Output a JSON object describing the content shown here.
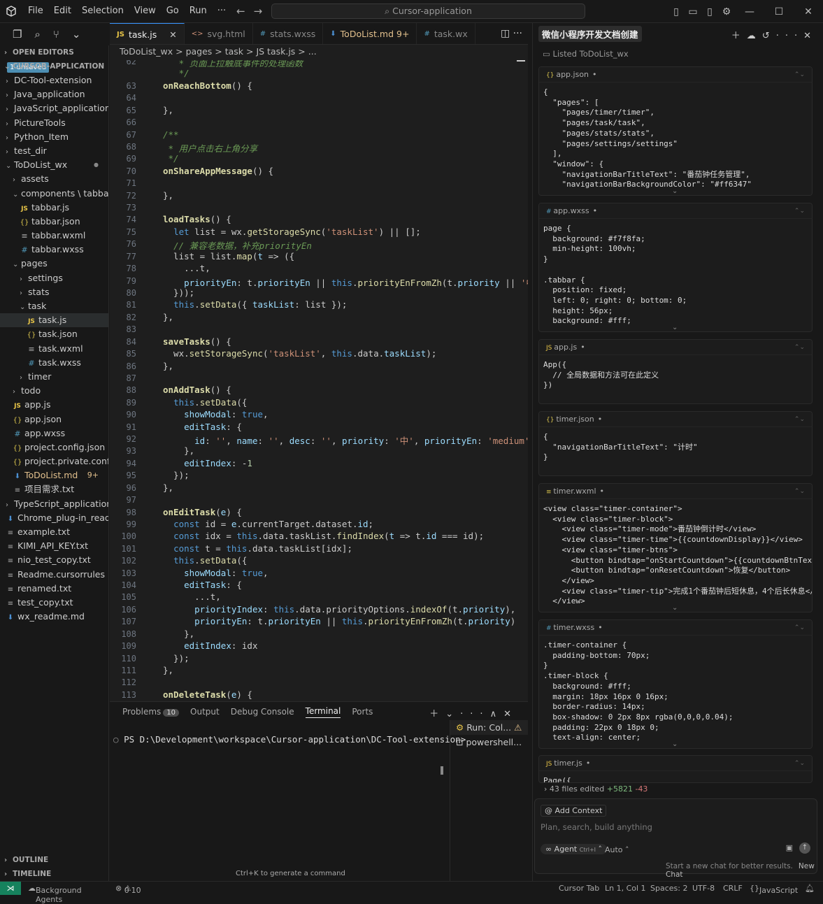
{
  "menu": [
    "File",
    "Edit",
    "Selection",
    "View",
    "Go",
    "Run",
    "···"
  ],
  "command_center": "Cursor-application",
  "sidebar": {
    "open_editors": "OPEN EDITORS",
    "unsaved": "1 unsaved",
    "root": "CURSOR-APPLICATION",
    "outline": "OUTLINE",
    "timeline": "TIMELINE",
    "items": [
      {
        "label": "DC-Tool-extension",
        "indent": 0,
        "type": "folder",
        "open": false
      },
      {
        "label": "Java_application",
        "indent": 0,
        "type": "folder",
        "open": false
      },
      {
        "label": "JavaScript_application",
        "indent": 0,
        "type": "folder",
        "open": false
      },
      {
        "label": "PictureTools",
        "indent": 0,
        "type": "folder",
        "open": false
      },
      {
        "label": "Python_Item",
        "indent": 0,
        "type": "folder",
        "open": false
      },
      {
        "label": "test_dir",
        "indent": 0,
        "type": "folder",
        "open": false
      },
      {
        "label": "ToDoList_wx",
        "indent": 0,
        "type": "folder",
        "open": true,
        "dot": true
      },
      {
        "label": "assets",
        "indent": 1,
        "type": "folder",
        "open": false
      },
      {
        "label": "components \\ tabbar",
        "indent": 1,
        "type": "folder",
        "open": true
      },
      {
        "label": "tabbar.js",
        "indent": 2,
        "type": "js"
      },
      {
        "label": "tabbar.json",
        "indent": 2,
        "type": "json"
      },
      {
        "label": "tabbar.wxml",
        "indent": 2,
        "type": "wxml"
      },
      {
        "label": "tabbar.wxss",
        "indent": 2,
        "type": "css"
      },
      {
        "label": "pages",
        "indent": 1,
        "type": "folder",
        "open": true
      },
      {
        "label": "settings",
        "indent": 2,
        "type": "folder",
        "open": false
      },
      {
        "label": "stats",
        "indent": 2,
        "type": "folder",
        "open": false
      },
      {
        "label": "task",
        "indent": 2,
        "type": "folder",
        "open": true
      },
      {
        "label": "task.js",
        "indent": 3,
        "type": "js",
        "selected": true
      },
      {
        "label": "task.json",
        "indent": 3,
        "type": "json"
      },
      {
        "label": "task.wxml",
        "indent": 3,
        "type": "wxml"
      },
      {
        "label": "task.wxss",
        "indent": 3,
        "type": "css"
      },
      {
        "label": "timer",
        "indent": 2,
        "type": "folder",
        "open": false
      },
      {
        "label": "todo",
        "indent": 1,
        "type": "folder",
        "open": false
      },
      {
        "label": "app.js",
        "indent": 1,
        "type": "js"
      },
      {
        "label": "app.json",
        "indent": 1,
        "type": "json"
      },
      {
        "label": "app.wxss",
        "indent": 1,
        "type": "css"
      },
      {
        "label": "project.config.json",
        "indent": 1,
        "type": "json"
      },
      {
        "label": "project.private.confi...",
        "indent": 1,
        "type": "json"
      },
      {
        "label": "ToDoList.md",
        "indent": 1,
        "type": "md",
        "badge": "9+",
        "modified": true
      },
      {
        "label": "项目需求.txt",
        "indent": 1,
        "type": "txt"
      },
      {
        "label": "TypeScript_application",
        "indent": 0,
        "type": "folder",
        "open": false
      },
      {
        "label": "Chrome_plug-in_read...",
        "indent": 0,
        "type": "md"
      },
      {
        "label": "example.txt",
        "indent": 0,
        "type": "txt"
      },
      {
        "label": "KIMI_API_KEY.txt",
        "indent": 0,
        "type": "txt"
      },
      {
        "label": "nio_test_copy.txt",
        "indent": 0,
        "type": "txt"
      },
      {
        "label": "Readme.cursorrules",
        "indent": 0,
        "type": "txt"
      },
      {
        "label": "renamed.txt",
        "indent": 0,
        "type": "txt"
      },
      {
        "label": "test_copy.txt",
        "indent": 0,
        "type": "txt"
      },
      {
        "label": "wx_readme.md",
        "indent": 0,
        "type": "md"
      }
    ]
  },
  "tabs": [
    {
      "label": "task.js",
      "icon": "JS",
      "active": true
    },
    {
      "label": "svg.html",
      "icon": "<>"
    },
    {
      "label": "stats.wxss",
      "icon": "#"
    },
    {
      "label": "ToDoList.md 9+",
      "icon": "md",
      "modified": true
    },
    {
      "label": "task.wx",
      "icon": "#"
    }
  ],
  "breadcrumb": "ToDoList_wx  >  pages  >  task  >  JS  task.js  > ...",
  "code": [
    {
      "n": "62",
      "h": "<span class='c'>   * 页面上拉触底事件的处理函数</span>"
    },
    {
      "n": "",
      "h": "<span class='c'>   */</span>"
    },
    {
      "n": "63",
      "h": "<span class='f'>onReachBottom</span>() {"
    },
    {
      "n": "64",
      "h": ""
    },
    {
      "n": "65",
      "h": "},"
    },
    {
      "n": "66",
      "h": ""
    },
    {
      "n": "67",
      "h": "<span class='c'>/**</span>"
    },
    {
      "n": "68",
      "h": "<span class='c'> * 用户点击右上角分享</span>"
    },
    {
      "n": "69",
      "h": "<span class='c'> */</span>"
    },
    {
      "n": "70",
      "h": "<span class='f'>onShareAppMessage</span>() {"
    },
    {
      "n": "71",
      "h": ""
    },
    {
      "n": "72",
      "h": "},"
    },
    {
      "n": "73",
      "h": ""
    },
    {
      "n": "74",
      "h": "<span class='f'>loadTasks</span>() {"
    },
    {
      "n": "75",
      "h": "  <span class='k'>let</span> list = wx.<span class='fn'>getStorageSync</span>(<span class='s'>'taskList'</span>) || [];"
    },
    {
      "n": "76",
      "h": "  <span class='c'>// 兼容老数据，补充priorityEn</span>"
    },
    {
      "n": "77",
      "h": "  list = list.<span class='fn'>map</span>(<span class='v'>t</span> =&gt; ({"
    },
    {
      "n": "78",
      "h": "    ...t,"
    },
    {
      "n": "79",
      "h": "    <span class='v'>priorityEn</span>: t.<span class='v'>priorityEn</span> || <span class='this'>this</span>.<span class='fn'>priorityEnFromZh</span>(t.<span class='v'>priority</span> || <span class='s'>'中'</span>)"
    },
    {
      "n": "80",
      "h": "  }));"
    },
    {
      "n": "81",
      "h": "  <span class='this'>this</span>.<span class='fn'>setData</span>({ <span class='v'>taskList</span>: list });"
    },
    {
      "n": "82",
      "h": "},"
    },
    {
      "n": "83",
      "h": ""
    },
    {
      "n": "84",
      "h": "<span class='f'>saveTasks</span>() {"
    },
    {
      "n": "85",
      "h": "  wx.<span class='fn'>setStorageSync</span>(<span class='s'>'taskList'</span>, <span class='this'>this</span>.data.<span class='v'>taskList</span>);"
    },
    {
      "n": "86",
      "h": "},"
    },
    {
      "n": "87",
      "h": ""
    },
    {
      "n": "88",
      "h": "<span class='f'>onAddTask</span>() {"
    },
    {
      "n": "89",
      "h": "  <span class='this'>this</span>.<span class='fn'>setData</span>({"
    },
    {
      "n": "90",
      "h": "    <span class='v'>showModal</span>: <span class='k'>true</span>,"
    },
    {
      "n": "91",
      "h": "    <span class='v'>editTask</span>: {"
    },
    {
      "n": "92",
      "h": "      <span class='v'>id</span>: <span class='s'>''</span>, <span class='v'>name</span>: <span class='s'>''</span>, <span class='v'>desc</span>: <span class='s'>''</span>, <span class='v'>priority</span>: <span class='s'>'中'</span>, <span class='v'>priorityEn</span>: <span class='s'>'medium'</span>, <span class='v'>pr</span>"
    },
    {
      "n": "93",
      "h": "    },"
    },
    {
      "n": "94",
      "h": "    <span class='v'>editIndex</span>: -<span class='n'>1</span>"
    },
    {
      "n": "95",
      "h": "  });"
    },
    {
      "n": "96",
      "h": "},"
    },
    {
      "n": "97",
      "h": ""
    },
    {
      "n": "98",
      "h": "<span class='f'>onEditTask</span>(<span class='v'>e</span>) {"
    },
    {
      "n": "99",
      "h": "  <span class='k'>const</span> id = <span class='v'>e</span>.currentTarget.dataset.<span class='v'>id</span>;"
    },
    {
      "n": "100",
      "h": "  <span class='k'>const</span> idx = <span class='this'>this</span>.data.taskList.<span class='fn'>findIndex</span>(<span class='v'>t</span> =&gt; t.<span class='v'>id</span> === id);"
    },
    {
      "n": "101",
      "h": "  <span class='k'>const</span> t = <span class='this'>this</span>.data.taskList[idx];"
    },
    {
      "n": "102",
      "h": "  <span class='this'>this</span>.<span class='fn'>setData</span>({"
    },
    {
      "n": "103",
      "h": "    <span class='v'>showModal</span>: <span class='k'>true</span>,"
    },
    {
      "n": "104",
      "h": "    <span class='v'>editTask</span>: {"
    },
    {
      "n": "105",
      "h": "      ...t,"
    },
    {
      "n": "106",
      "h": "      <span class='v'>priorityIndex</span>: <span class='this'>this</span>.data.priorityOptions.<span class='fn'>indexOf</span>(t.<span class='v'>priority</span>),"
    },
    {
      "n": "107",
      "h": "      <span class='v'>priorityEn</span>: t.<span class='v'>priorityEn</span> || <span class='this'>this</span>.<span class='fn'>priorityEnFromZh</span>(t.<span class='v'>priority</span>)"
    },
    {
      "n": "108",
      "h": "    },"
    },
    {
      "n": "109",
      "h": "    <span class='v'>editIndex</span>: idx"
    },
    {
      "n": "110",
      "h": "  });"
    },
    {
      "n": "111",
      "h": "},"
    },
    {
      "n": "112",
      "h": ""
    },
    {
      "n": "113",
      "h": "<span class='f'>onDeleteTask</span>(<span class='v'>e</span>) {"
    }
  ],
  "panel": {
    "tabs": [
      "Problems",
      "Output",
      "Debug Console",
      "Terminal",
      "Ports"
    ],
    "problems_count": "10",
    "terminal_line": "PS D:\\Development\\workspace\\Cursor-application\\DC-Tool-extension>",
    "terminals": [
      "Run: Col...",
      "powershell..."
    ],
    "hint": "Ctrl+K to generate a command"
  },
  "chat": {
    "title": "微信小程序开发文档创建",
    "listed": "Listed ToDoList_wx",
    "cards": [
      {
        "file": "app.json",
        "icon": "{}",
        "code": "{\n  \"pages\": [\n    \"pages/timer/timer\",\n    \"pages/task/task\",\n    \"pages/stats/stats\",\n    \"pages/settings/settings\"\n  ],\n  \"window\": {\n    \"navigationBarTitleText\": \"番茄钟任务管理\",\n    \"navigationBarBackgroundColor\": \"#ff6347\""
      },
      {
        "file": "app.wxss",
        "icon": "#",
        "code": "page {\n  background: #f7f8fa;\n  min-height: 100vh;\n}\n\n.tabbar {\n  position: fixed;\n  left: 0; right: 0; bottom: 0;\n  height: 56px;\n  background: #fff;"
      },
      {
        "file": "app.js",
        "icon": "JS",
        "code": "App({\n  // 全局数据和方法可在此定义\n})"
      },
      {
        "file": "timer.json",
        "icon": "{}",
        "code": "{\n  \"navigationBarTitleText\": \"计时\"\n}"
      },
      {
        "file": "timer.wxml",
        "icon": "≡",
        "code": "<view class=\"timer-container\">\n  <view class=\"timer-block\">\n    <view class=\"timer-mode\">番茄钟倒计时</view>\n    <view class=\"timer-time\">{{countdownDisplay}}</view>\n    <view class=\"timer-btns\">\n      <button bindtap=\"onStartCountdown\">{{countdownBtnText}}</\n      <button bindtap=\"onResetCountdown\">恢复</button>\n    </view>\n    <view class=\"timer-tip\">完成1个番茄钟后短休息，4个后长休息</v\n  </view>"
      },
      {
        "file": "timer.wxss",
        "icon": "#",
        "code": ".timer-container {\n  padding-bottom: 70px;\n}\n.timer-block {\n  background: #fff;\n  margin: 18px 16px 0 16px;\n  border-radius: 14px;\n  box-shadow: 0 2px 8px rgba(0,0,0,0.04);\n  padding: 22px 0 18px 0;\n  text-align: center;"
      },
      {
        "file": "timer.js",
        "icon": "JS",
        "code": "Page({"
      }
    ],
    "edited": "43 files edited",
    "plus": "+5821",
    "minus": "-43",
    "add_context": "Add Context",
    "placeholder": "Plan, search, build anything",
    "agent": "Agent",
    "agent_shortcut": "Ctrl+I",
    "auto": "Auto",
    "footer": "Start a new chat for better results.",
    "new_chat": "New Chat"
  },
  "status": {
    "bg_agents": "Background Agents",
    "errors": "0",
    "warnings": "10",
    "cursor_tab": "Cursor Tab",
    "position": "Ln 1, Col 1",
    "spaces": "Spaces: 2",
    "encoding": "UTF-8",
    "eol": "CRLF",
    "language": "JavaScript"
  }
}
